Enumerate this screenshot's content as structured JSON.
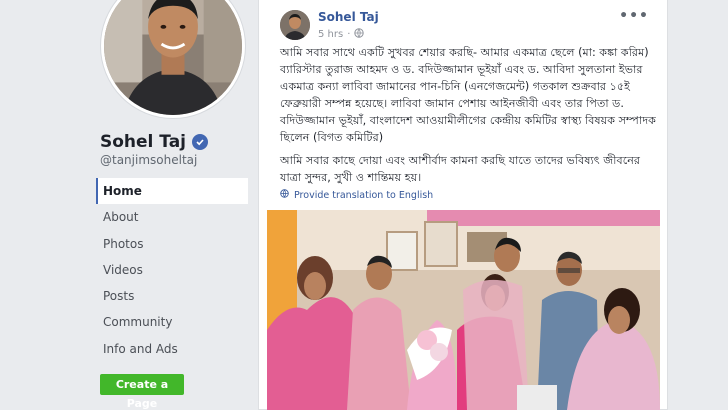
{
  "profile": {
    "name": "Sohel Taj",
    "handle": "@tanjimsoheltaj"
  },
  "nav": {
    "items": [
      {
        "label": "Home"
      },
      {
        "label": "About"
      },
      {
        "label": "Photos"
      },
      {
        "label": "Videos"
      },
      {
        "label": "Posts"
      },
      {
        "label": "Community"
      },
      {
        "label": "Info and Ads"
      }
    ]
  },
  "create_page_label": "Create a Page",
  "post": {
    "author": "Sohel Taj",
    "time": "5 hrs",
    "more_label": "•••",
    "paragraphs": [
      "আমি সবার সাথে একটি সুখবর শেয়ার করছি- আমার একমাত্র ছেলে (মা: কঙ্কা করিম) ব্যারিস্টার তুরাজ আহমদ ও ড. বদিউজ্জামান ভূইয়াঁ এবং ড. আবিদা সুলতানা ইভার একমাত্র কন্যা লাবিবা জামানের পান-চিনি (এনগেজমেন্ট) গতকাল শুক্রবার ১৫ই ফেব্রুয়ারী সম্পন্ন হয়েছে। লাবিবা জামান পেশায় আইনজীবী এবং তার পিতা ড. বদিউজ্জামান ভূইয়াঁ, বাংলাদেশ আওয়ামীলীগের কেন্দ্রীয় কমিটির স্বাস্থ্য বিষয়ক সম্পাদক ছিলেন (বিগত কমিটির)",
      "আমি সবার কাছে দোয়া এবং আশীর্বাদ কামনা করছি যাতে তাদের ভবিষ্যৎ জীবনের যাত্রা সুন্দর, সুখী ও শান্তিময় হয়।"
    ],
    "translate_label": "Provide translation to English"
  },
  "colors": {
    "brand_blue": "#4267b2",
    "link_blue": "#365899",
    "green": "#42b72a",
    "background": "#e9ebee"
  }
}
